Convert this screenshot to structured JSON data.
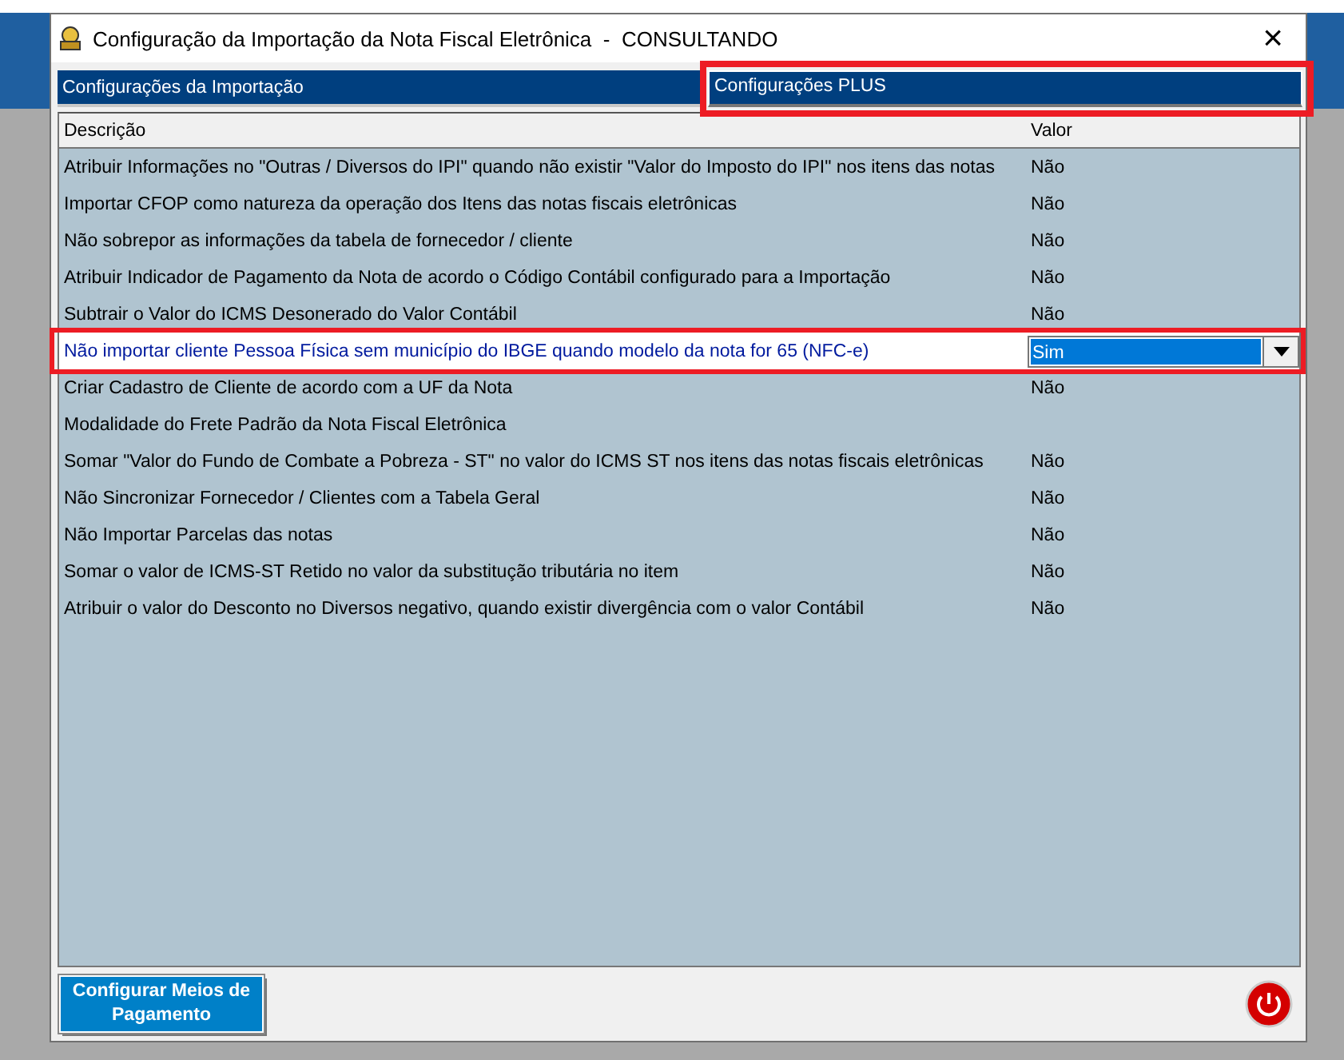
{
  "window": {
    "title": "Configuração da Importação da Nota Fiscal Eletrônica  -  CONSULTANDO",
    "close": "×"
  },
  "tabs": [
    {
      "label": "Configurações da Importação",
      "selected": false
    },
    {
      "label": "Configurações PLUS",
      "selected": true
    }
  ],
  "table": {
    "columns": [
      "Descrição",
      "Valor"
    ],
    "rows": [
      {
        "description": "Atribuir Informações no \"Outras / Diversos do IPI\" quando não existir \"Valor do Imposto do IPI\" nos itens das notas",
        "value": "Não",
        "selected": false
      },
      {
        "description": "Importar CFOP como natureza da operação dos Itens das notas fiscais eletrônicas",
        "value": "Não",
        "selected": false
      },
      {
        "description": "Não sobrepor as informações da tabela de fornecedor / cliente",
        "value": "Não",
        "selected": false
      },
      {
        "description": "Atribuir Indicador de Pagamento da Nota de acordo o Código Contábil configurado para a Importação",
        "value": "Não",
        "selected": false
      },
      {
        "description": "Subtrair o Valor do ICMS Desonerado do Valor Contábil",
        "value": "Não",
        "selected": false
      },
      {
        "description": "Não importar cliente Pessoa Física sem município do IBGE quando modelo da nota for 65 (NFC-e)",
        "value": "Sim",
        "selected": true
      },
      {
        "description": "Criar Cadastro de Cliente de acordo com a UF da Nota",
        "value": "Não",
        "selected": false
      },
      {
        "description": "Modalidade do Frete Padrão da Nota Fiscal Eletrônica",
        "selected": false
      },
      {
        "description": "Somar \"Valor do Fundo de Combate a Pobreza - ST\" no valor do ICMS ST nos itens das notas fiscais eletrônicas",
        "value": "Não",
        "selected": false
      },
      {
        "description": "Não Sincronizar Fornecedor / Clientes com a Tabela Geral",
        "value": "Não",
        "selected": false
      },
      {
        "description": "Não Importar Parcelas das notas",
        "value": "Não",
        "selected": false
      },
      {
        "description": "Somar o valor de ICMS-ST Retido no valor da substitução tributária no item",
        "value": "Não",
        "selected": false
      },
      {
        "description": "Atribuir o valor do Desconto no Diversos negativo, quando existir divergência com o valor Contábil",
        "value": "Não",
        "selected": false
      }
    ]
  },
  "buttons": [
    {
      "label": "Configurar Meios de Pagamento",
      "kind": "text"
    },
    {
      "kind": "power"
    }
  ]
}
